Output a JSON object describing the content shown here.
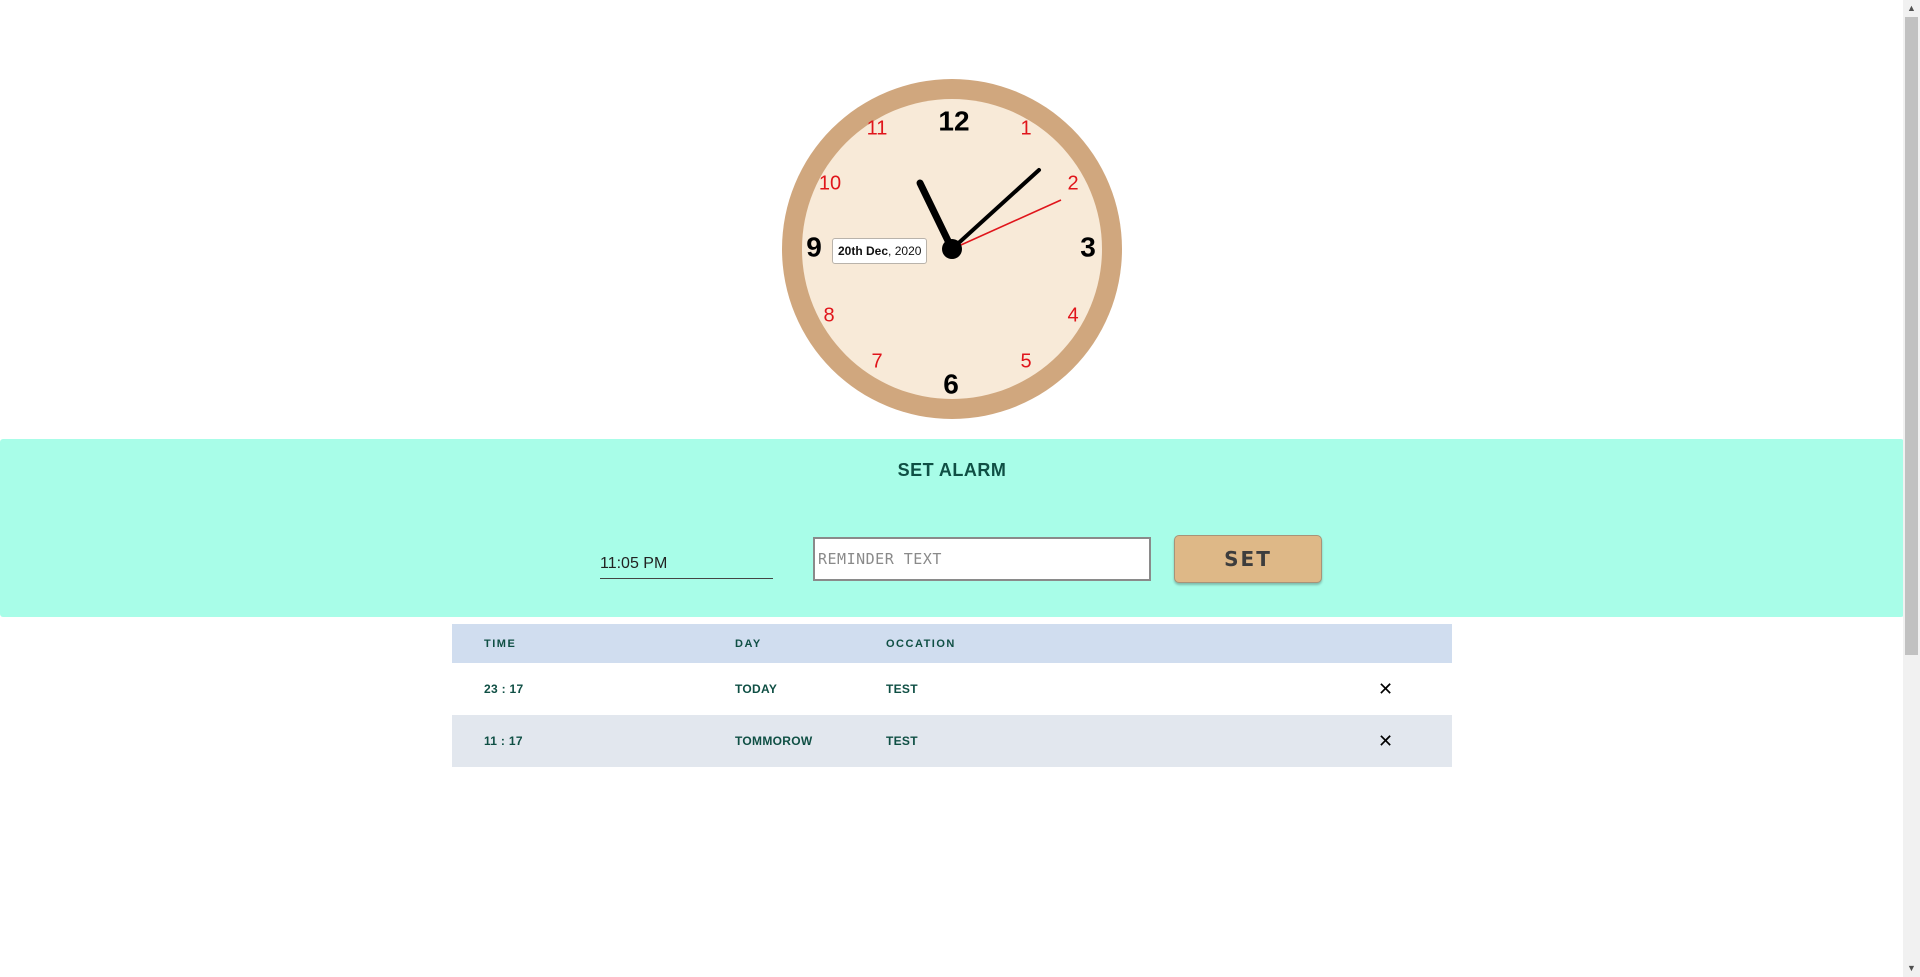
{
  "clock": {
    "numbers_main": [
      "12",
      "3",
      "6",
      "9"
    ],
    "numbers_minor": [
      "1",
      "2",
      "4",
      "5",
      "7",
      "8",
      "10",
      "11"
    ],
    "date_day": "20th Dec",
    "date_sep": ",",
    "date_year": "2020",
    "face_color": "#f8ead8",
    "rim_color": "#d0a77e",
    "second_hand_color": "#e0151b"
  },
  "alarm": {
    "title": "SET ALARM",
    "time_value": "11:05 PM",
    "reminder_placeholder": "REMINDER TEXT",
    "set_label": "SET",
    "band_color": "#a8fde8",
    "button_color": "#deb887"
  },
  "table": {
    "headers": [
      "TIME",
      "DAY",
      "OCCATION"
    ],
    "rows": [
      {
        "time": "23 : 17",
        "day": "TODAY",
        "occasion": "TEST"
      },
      {
        "time": "11 : 17",
        "day": "TOMMOROW",
        "occasion": "TEST"
      }
    ],
    "delete_icon": "close-icon",
    "header_color": "#d0ddef"
  }
}
